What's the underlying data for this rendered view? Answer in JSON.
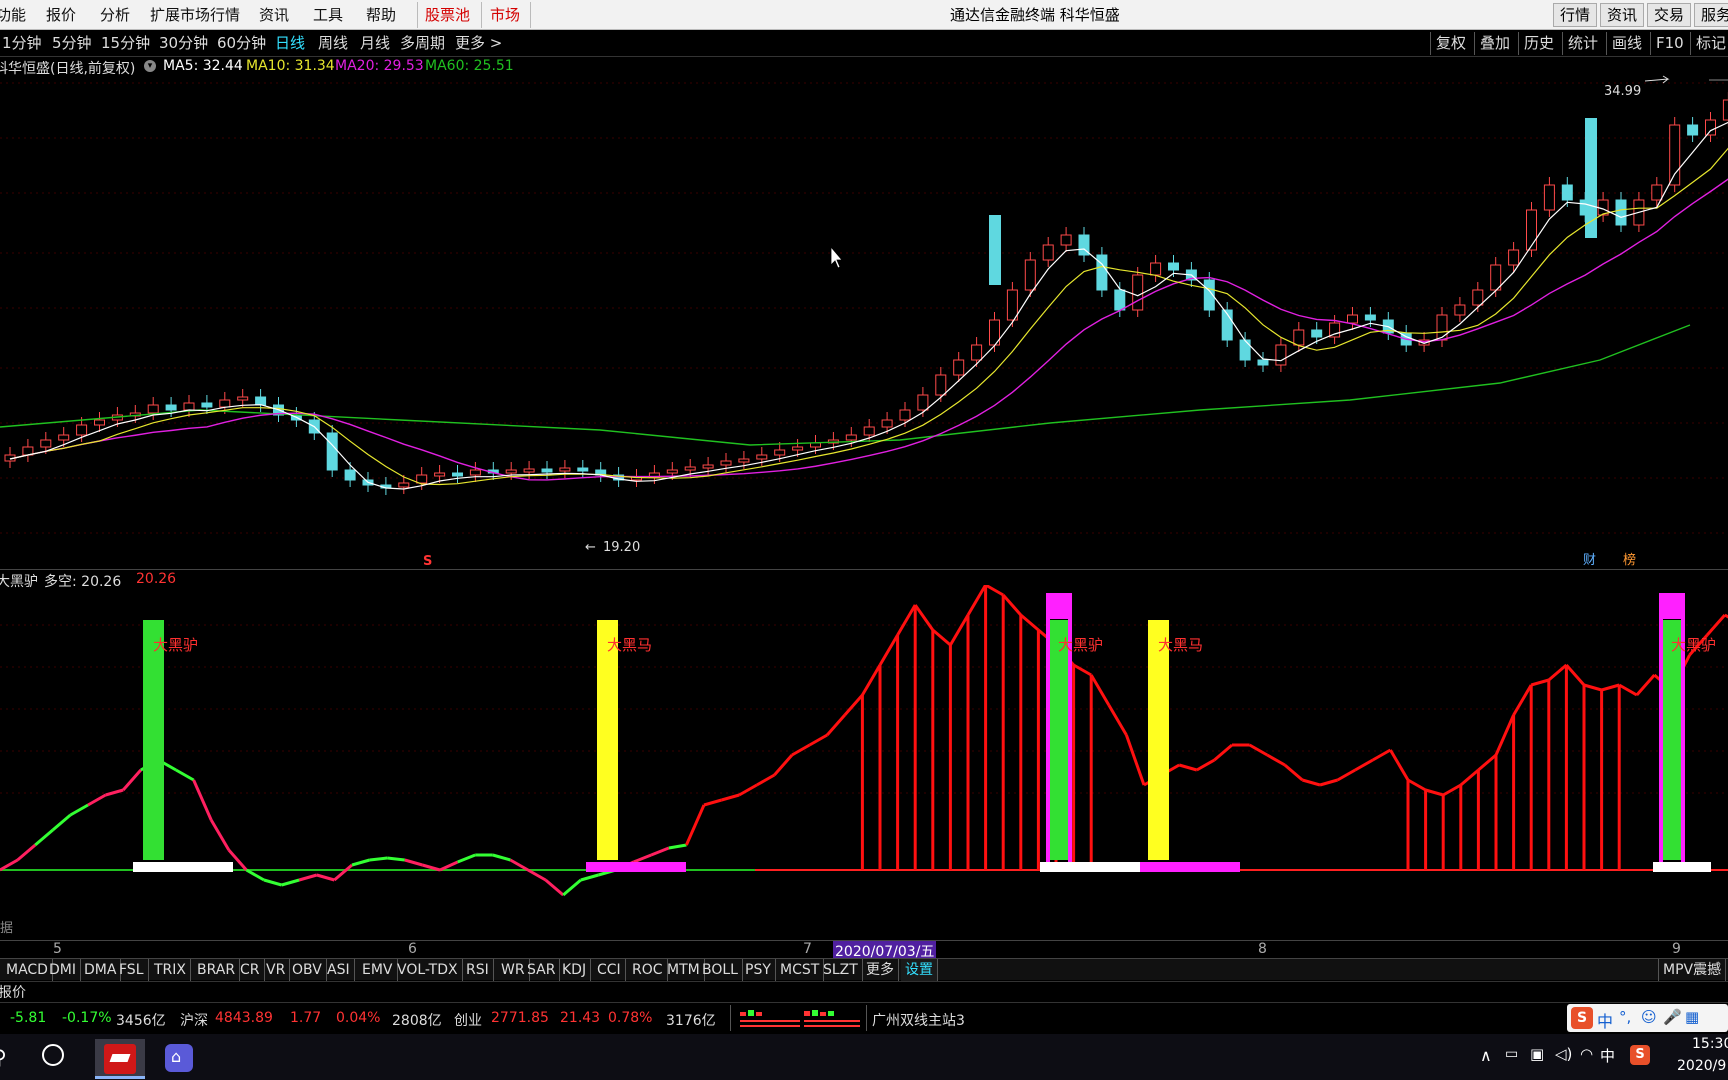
{
  "menu": {
    "items": [
      "功能",
      "报价",
      "分析",
      "扩展市场行情",
      "资讯",
      "工具",
      "帮助"
    ],
    "highlight_items": [
      "股票池",
      "市场"
    ],
    "title": "通达信金融终端  科华恒盛",
    "right_buttons": [
      "行情",
      "资讯",
      "交易",
      "服务"
    ]
  },
  "periods": {
    "items": [
      "1分钟",
      "5分钟",
      "15分钟",
      "30分钟",
      "60分钟",
      "日线",
      "周线",
      "月线",
      "多周期",
      "更多 >"
    ],
    "active": "日线",
    "tools": [
      "复权",
      "叠加",
      "历史",
      "统计",
      "画线",
      "F10",
      "标记"
    ]
  },
  "main_chart": {
    "stock_label": "科华恒盛(日线,前复权)",
    "ma5": "MA5: 32.44",
    "ma10": "MA10: 31.34",
    "ma20": "MA20: 29.53",
    "ma60": "MA60: 25.51",
    "high_label": "34.99",
    "low_label": "19.20",
    "marker_s": "S",
    "badge_cai": "财",
    "badge_bang": "榜",
    "colors": {
      "ma5": "#ffffff",
      "ma10": "#e6e62e",
      "ma20": "#e020e0",
      "ma60": "#20c020",
      "up": "#ff4a4a",
      "down": "#5fd8e0"
    }
  },
  "indicator": {
    "title": "大黑驴",
    "dk_label": "多空: 20.26",
    "dk_value": "20.26",
    "signal_labels": [
      "大黑驴",
      "大黑马",
      "大黑驴",
      "大黑马",
      "大黑驴"
    ]
  },
  "date_axis": {
    "labels": [
      "5",
      "6",
      "7",
      "8",
      "9"
    ],
    "cursor_date": "2020/07/03/五"
  },
  "indicator_tabs": {
    "items": [
      "MACD",
      "DMI",
      "DMA",
      "FSL",
      "TRIX",
      "BRAR",
      "CR",
      "VR",
      "OBV",
      "ASI",
      "EMV",
      "VOL-TDX",
      "RSI",
      "WR",
      "SAR",
      "KDJ",
      "CCI",
      "ROC",
      "MTM",
      "BOLL",
      "PSY",
      "MCST",
      "SLZT",
      "更多",
      "设置"
    ],
    "active": "设置",
    "right_label": "MPV震撼"
  },
  "quote_bar": {
    "label": "报价"
  },
  "ticker": {
    "sh_change": "-5.81",
    "sh_pct": "-0.17%",
    "sh_amount": "3456亿",
    "hs_name": "沪深",
    "hs_index": "4843.89",
    "hs_change": "1.77",
    "hs_pct": "0.04%",
    "hs_amount": "2808亿",
    "cy_name": "创业",
    "cy_index": "2771.85",
    "cy_change": "21.43",
    "cy_pct": "0.78%",
    "cy_amount": "3176亿",
    "station": "广州双线主站3"
  },
  "tray": {
    "ime": "中",
    "ime2": "中",
    "time": "15:30",
    "date": "2020/9"
  }
}
